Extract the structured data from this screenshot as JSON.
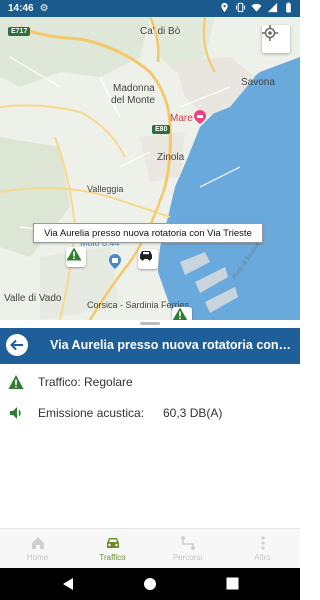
{
  "status_bar": {
    "time": "14:46",
    "icons": [
      "gear-icon",
      "location-icon",
      "vibrate-icon",
      "wifi-icon",
      "signal-icon",
      "battery-icon"
    ]
  },
  "map": {
    "labels": {
      "ca_di_bo": "Ca' di Bò",
      "madonna_line1": "Madonna",
      "madonna_line2": "del Monte",
      "savona": "Savona",
      "mare": "Mare",
      "zinola": "Zinola",
      "valleggia": "Valleggia",
      "molo": "Molo 8.44",
      "valle_di_vado": "Valle di Vado",
      "corsica": "Corsica - Sardinia Ferries",
      "via_line_1": "Porto di Savona",
      "via_line_2": "Molo Lagoa"
    },
    "road_shields": [
      "E717",
      "E80"
    ],
    "callout": "Via Aurelia presso nuova rotatoria con Via Trieste"
  },
  "detail": {
    "title": "Via Aurelia presso nuova rotatoria con Via Trieste",
    "rows": [
      {
        "icon": "warning-icon",
        "label": "Traffico: Regolare",
        "value": ""
      },
      {
        "icon": "volume-icon",
        "label": "Emissione acustica:",
        "value": "60,3 DB(A)"
      }
    ]
  },
  "bottom_nav": {
    "items": [
      {
        "label": "Home",
        "icon": "home-icon",
        "active": false
      },
      {
        "label": "Traffico",
        "icon": "car-icon",
        "active": true
      },
      {
        "label": "Percorsi",
        "icon": "route-icon",
        "active": false
      },
      {
        "label": "Altro",
        "icon": "more-icon",
        "active": false
      }
    ]
  },
  "colors": {
    "status_bar": "#1b5a8c",
    "title_bar": "#1f5f99",
    "active_tab": "#6f8c2b",
    "warning_green": "#2e7d32",
    "sea": "#6aa9dc"
  }
}
